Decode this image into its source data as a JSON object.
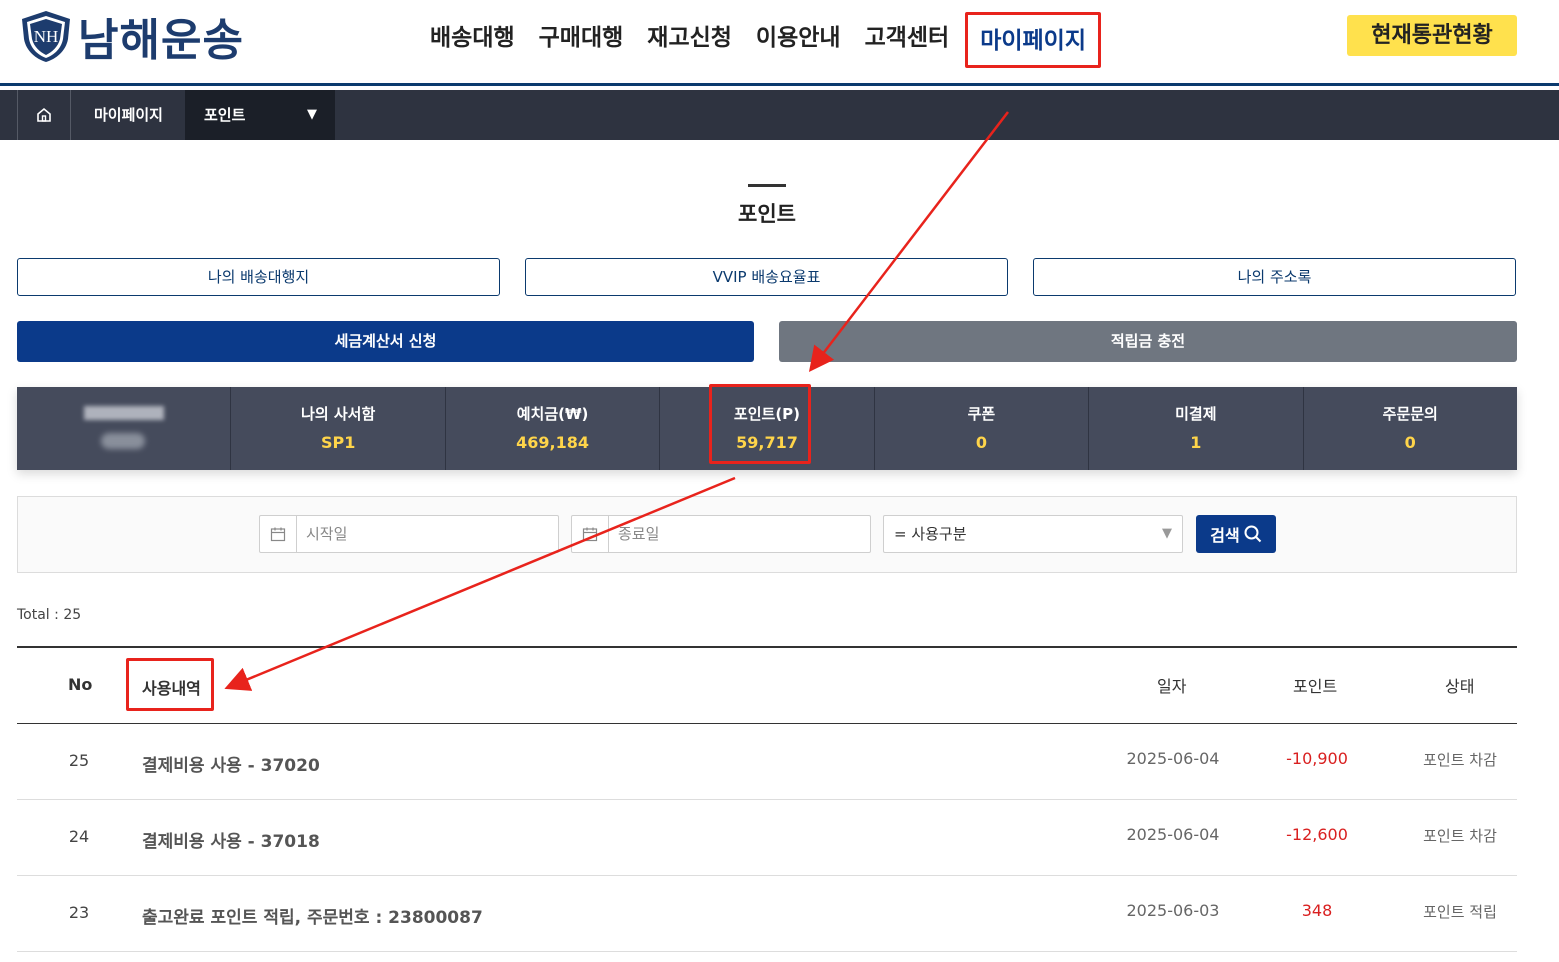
{
  "header": {
    "logo_badge": "NH",
    "logo_text": "남해운송",
    "nav": [
      "배송대행",
      "구매대행",
      "재고신청",
      "이용안내",
      "고객센터",
      "마이페이지"
    ],
    "status_button": "현재통관현황"
  },
  "breadcrumb": {
    "mypage": "마이페이지",
    "current": "포인트",
    "caret": "▼"
  },
  "page_title": "포인트",
  "buttons": {
    "my_shipping_address": "나의 배송대행지",
    "vvip_rates": "VVIP 배송요율표",
    "my_address_book": "나의 주소록",
    "tax_invoice": "세금계산서 신청",
    "charge_deposit": "적립금 충전"
  },
  "colors": {
    "primary": "#0b3a8a",
    "secondary": "#6f7680",
    "stats_bg": "#454b5c",
    "stat_value": "#ffd54a",
    "negative": "#d92020",
    "annotation": "#e8231c",
    "status_button": "#ffe14d"
  },
  "stats": [
    {
      "label": "나의 사서함",
      "value": "SP1"
    },
    {
      "label": "예치금(₩)",
      "value": "469,184"
    },
    {
      "label": "포인트(P)",
      "value": "59,717"
    },
    {
      "label": "쿠폰",
      "value": "0"
    },
    {
      "label": "미결제",
      "value": "1"
    },
    {
      "label": "주문문의",
      "value": "0"
    }
  ],
  "search": {
    "start_placeholder": "시작일",
    "end_placeholder": "종료일",
    "type_select": "= 사용구분",
    "select_caret": "▼",
    "button": "검색"
  },
  "total": "Total : 25",
  "table": {
    "headers": {
      "no": "No",
      "desc": "사용내역",
      "date": "일자",
      "points": "포인트",
      "status": "상태"
    },
    "rows": [
      {
        "no": "25",
        "desc": "결제비용 사용 - 37020",
        "date": "2025-06-04",
        "points": "-10,900",
        "status": "포인트 차감"
      },
      {
        "no": "24",
        "desc": "결제비용 사용 - 37018",
        "date": "2025-06-04",
        "points": "-12,600",
        "status": "포인트 차감"
      },
      {
        "no": "23",
        "desc": "출고완료 포인트 적립, 주문번호 : 23800087",
        "date": "2025-06-03",
        "points": "348",
        "status": "포인트 적립"
      }
    ]
  }
}
